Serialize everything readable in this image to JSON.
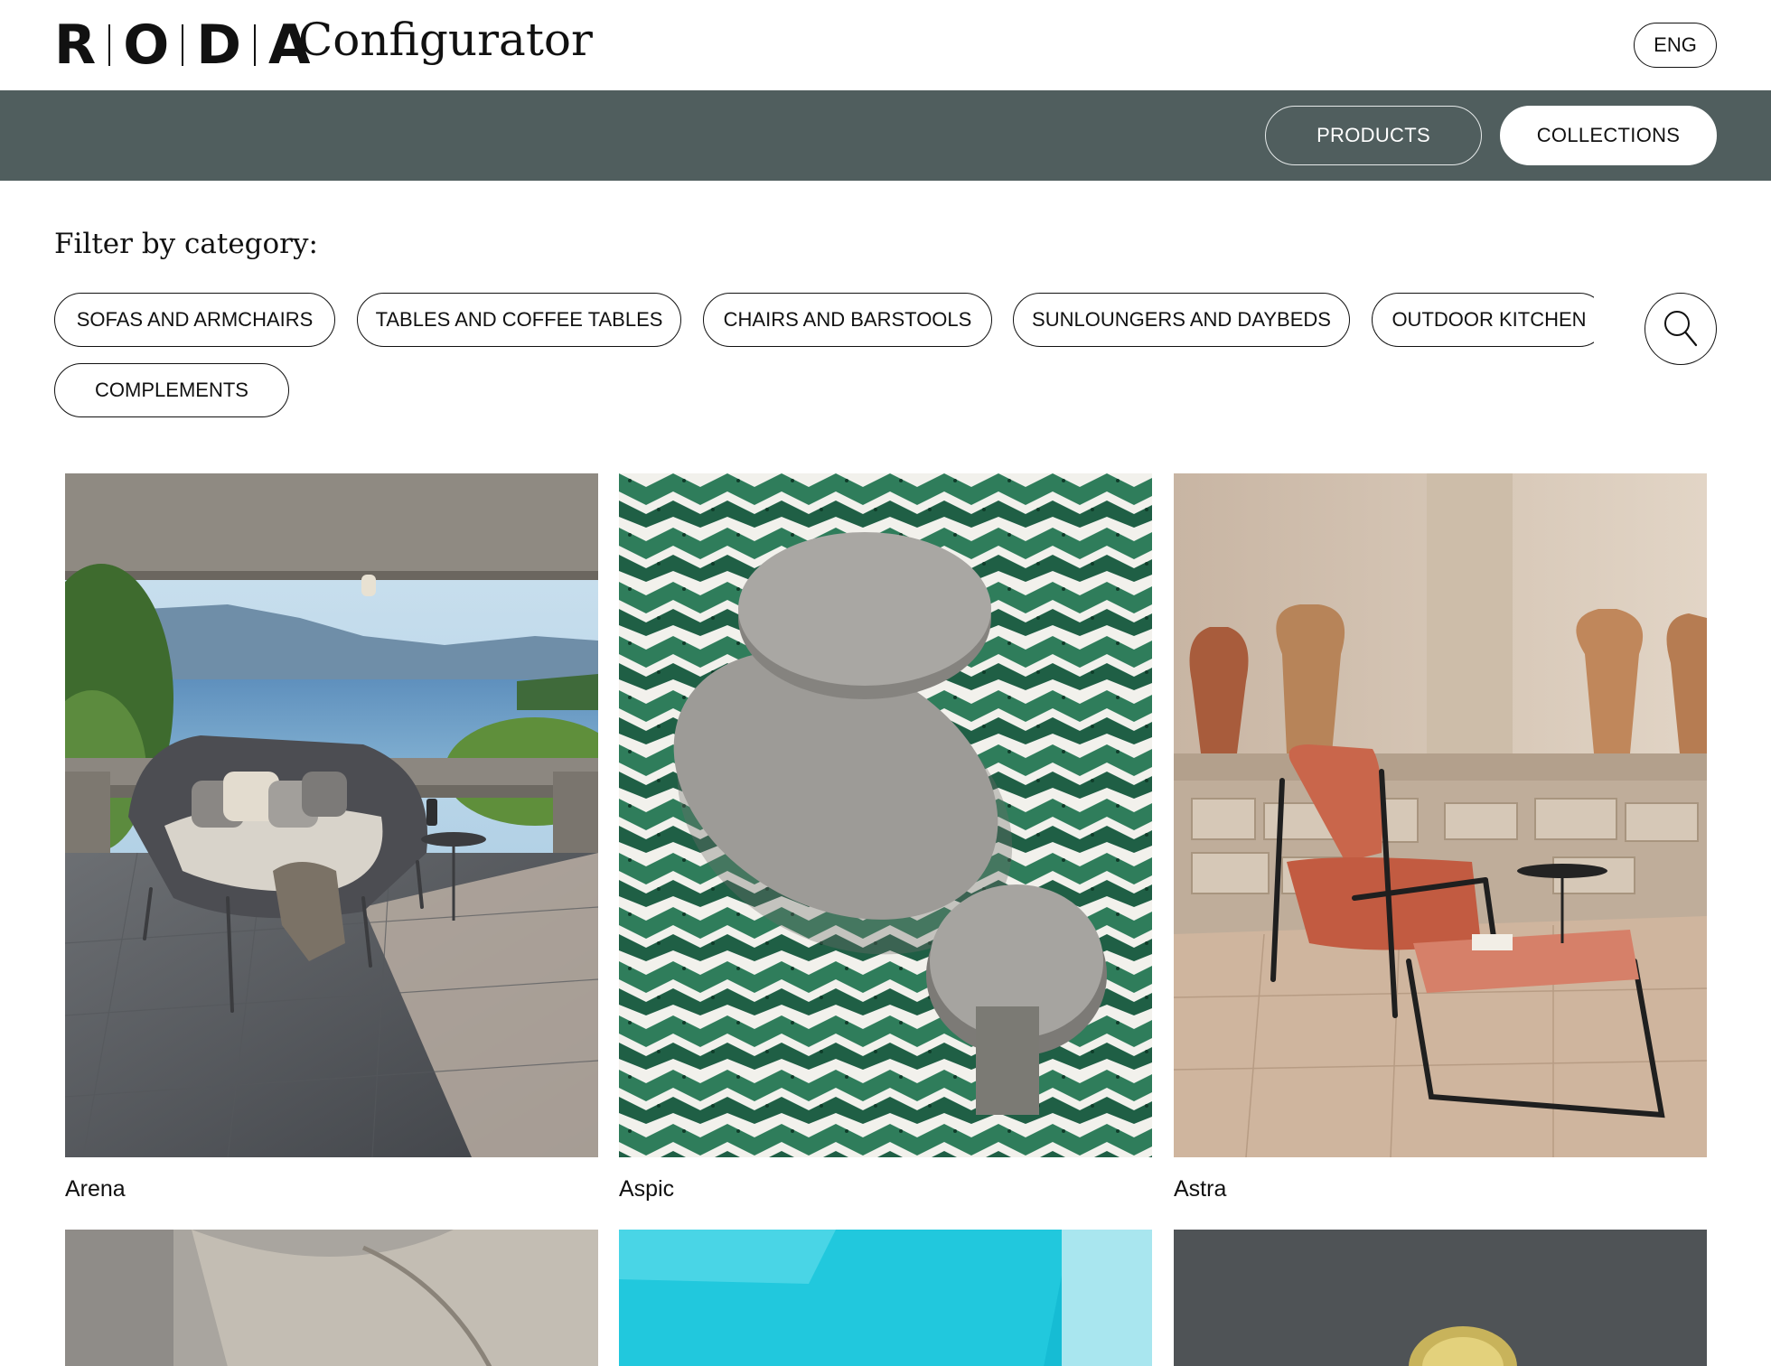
{
  "header": {
    "logo_letters": [
      "R",
      "O",
      "D",
      "A"
    ],
    "logo_word": "Configurator",
    "language": "ENG"
  },
  "nav": {
    "products": "PRODUCTS",
    "collections": "COLLECTIONS",
    "active": "COLLECTIONS"
  },
  "filter": {
    "title": "Filter by category:",
    "categories": [
      "SOFAS AND ARMCHAIRS",
      "TABLES AND COFFEE TABLES",
      "CHAIRS AND BARSTOOLS",
      "SUNLOUNGERS AND DAYBEDS",
      "OUTDOOR KITCHEN",
      "COMPLEMENTS"
    ],
    "search_icon": "search-icon"
  },
  "collections": [
    {
      "name": "Arena",
      "image": "terrace daybed overlooking lake"
    },
    {
      "name": "Aspic",
      "image": "round coffee tables on green and white tiles"
    },
    {
      "name": "Astra",
      "image": "terracotta lounge chair with footstool"
    }
  ],
  "colors": {
    "navband": "#505e5e",
    "text": "#111111",
    "background": "#ffffff"
  }
}
